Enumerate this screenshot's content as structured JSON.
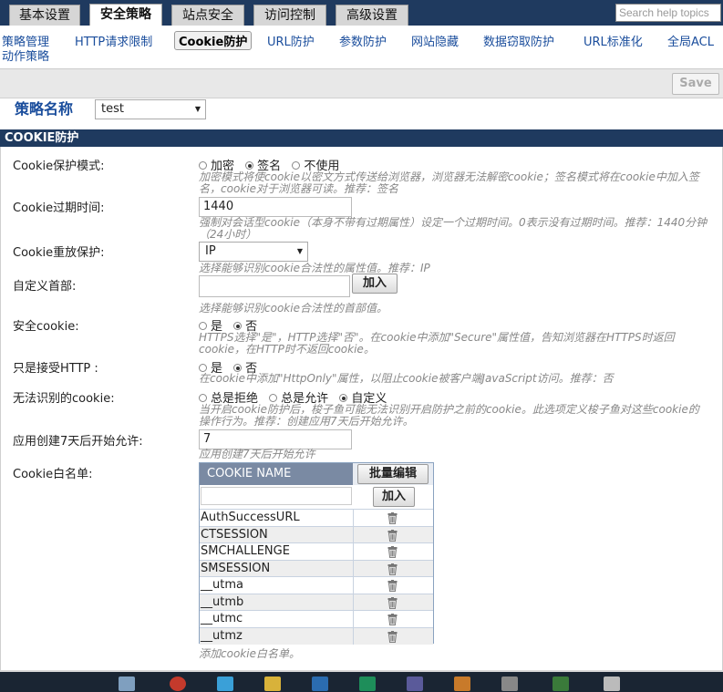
{
  "top_tabs": [
    "基本设置",
    "安全策略",
    "站点安全",
    "访问控制",
    "高级设置"
  ],
  "search_placeholder": "Search help topics",
  "subnav": [
    "策略管理",
    "动作策略",
    "HTTP请求限制",
    "Cookie防护",
    "URL防护",
    "参数防护",
    "网站隐藏",
    "数据窃取防护",
    "URL标准化",
    "全局ACL"
  ],
  "save_label": "Save",
  "policy": {
    "label": "策略名称",
    "value": "test"
  },
  "section_title": "COOKIE防护",
  "fields": {
    "mode": {
      "label": "Cookie保护模式:",
      "options": [
        "加密",
        "签名",
        "不使用"
      ],
      "selected": "签名",
      "hint": "加密模式将使cookie以密文方式传送给浏览器，浏览器无法解密cookie；签名模式将在cookie中加入签名，cookie对于浏览器可读。推荐：签名"
    },
    "expire": {
      "label": "Cookie过期时间:",
      "value": "1440",
      "hint": "强制对会话型cookie（本身不带有过期属性）设定一个过期时间。0表示没有过期时间。推荐：1440分钟（24小时）"
    },
    "replay": {
      "label": "Cookie重放保护:",
      "value": "IP",
      "hint": "选择能够识别cookie合法性的属性值。推荐：IP"
    },
    "custom_header": {
      "label": "自定义首部:",
      "add_label": "加入",
      "hint": "选择能够识别cookie合法性的首部值。"
    },
    "secure": {
      "label": "安全cookie:",
      "options": [
        "是",
        "否"
      ],
      "selected": "否",
      "hint": "HTTPS选择\"是\"，HTTP选择\"否\"。在cookie中添加\"Secure\"属性值，告知浏览器在HTTPS时返回cookie，在HTTP时不返回cookie。"
    },
    "http_only": {
      "label": "只是接受HTTP :",
      "options": [
        "是",
        "否"
      ],
      "selected": "否",
      "hint": "在cookie中添加\"HttpOnly\"属性，以阻止cookie被客户端JavaScript访问。推荐：否"
    },
    "unknown": {
      "label": "无法识别的cookie:",
      "options": [
        "总是拒绝",
        "总是允许",
        "自定义"
      ],
      "selected": "自定义",
      "hint": "当开启cookie防护后，梭子鱼可能无法识别开启防护之前的cookie。此选项定义梭子鱼对这些cookie的操作行为。推荐：创建应用7天后开始允许。"
    },
    "allow_after": {
      "label": "应用创建7天后开始允许:",
      "value": "7",
      "hint": "应用创建7天后开始允许"
    },
    "whitelist": {
      "label": "Cookie白名单:",
      "column": "COOKIE NAME",
      "batch_label": "批量编辑",
      "add_label": "加入",
      "rows": [
        "AuthSuccessURL",
        "CTSESSION",
        "SMCHALLENGE",
        "SMSESSION",
        "__utma",
        "__utmb",
        "__utmc",
        "__utmz"
      ],
      "hint": "添加cookie白名单。"
    }
  }
}
